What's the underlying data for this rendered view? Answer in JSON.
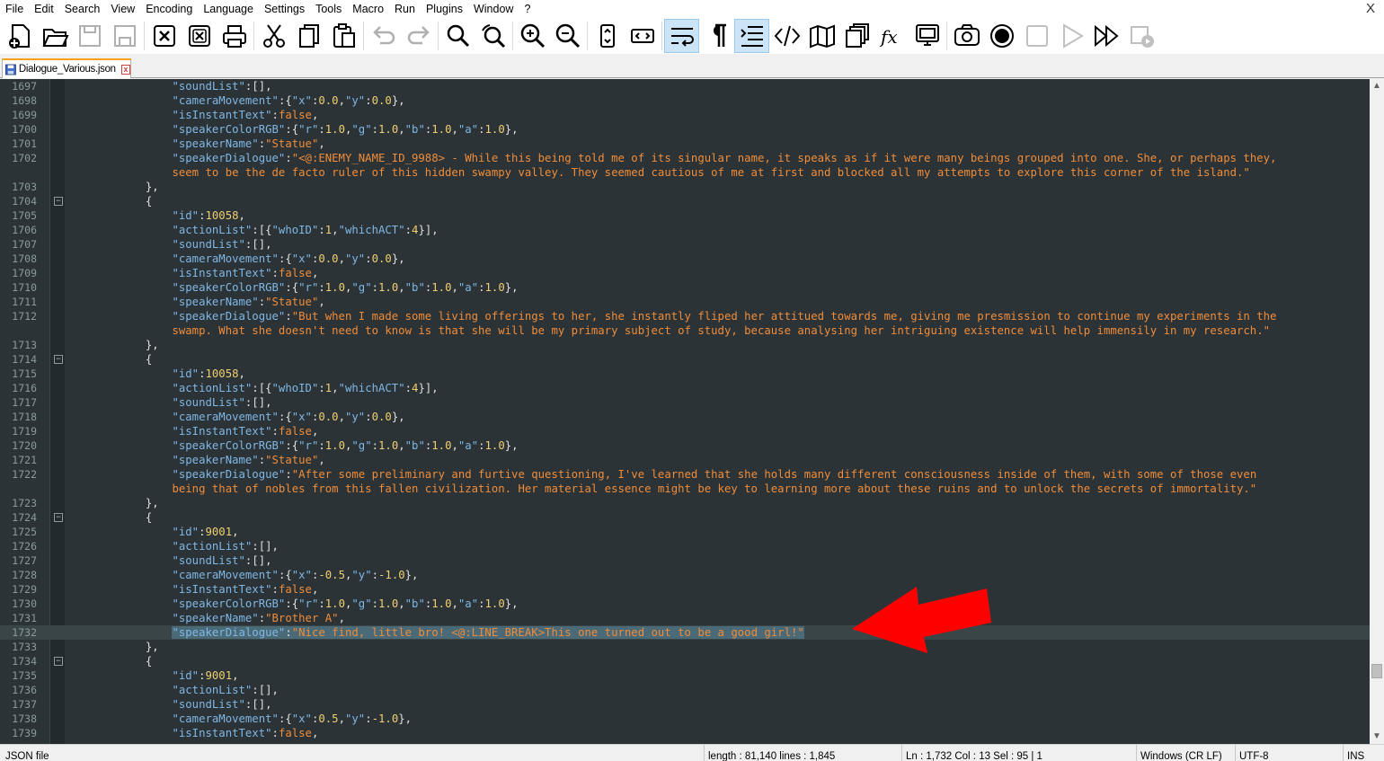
{
  "menu": {
    "items": [
      "File",
      "Edit",
      "Search",
      "View",
      "Encoding",
      "Language",
      "Settings",
      "Tools",
      "Macro",
      "Run",
      "Plugins",
      "Window",
      "?"
    ],
    "close_glyph": "X"
  },
  "toolbar": {
    "buttons": [
      "new-file",
      "open-file",
      "save",
      "save-all",
      "close",
      "close-all",
      "print",
      "cut",
      "copy",
      "paste",
      "undo",
      "redo",
      "find",
      "replace",
      "zoom-in",
      "zoom-out",
      "sync-vertical",
      "sync-horizontal",
      "word-wrap",
      "show-all-chars",
      "indent-guide",
      "udl",
      "document-map",
      "doc-list",
      "function-list",
      "folder-workspace",
      "monitoring",
      "record-macro",
      "stop-record",
      "playback",
      "run-multiple",
      "save-macro"
    ]
  },
  "tab": {
    "label": "Dialogue_Various.json",
    "close_glyph": "x"
  },
  "editor": {
    "accent_key": "#7fb7e6",
    "accent_string": "#f08c3a",
    "accent_number": "#f0d070",
    "lines": [
      {
        "n": "1697",
        "code": "                \"soundList\":[],"
      },
      {
        "n": "1698",
        "code": "                \"cameraMovement\":{\"x\":0.0,\"y\":0.0},"
      },
      {
        "n": "1699",
        "code": "                \"isInstantText\":false,"
      },
      {
        "n": "1700",
        "code": "                \"speakerColorRGB\":{\"r\":1.0,\"g\":1.0,\"b\":1.0,\"a\":1.0},"
      },
      {
        "n": "1701",
        "code": "                \"speakerName\":\"Statue\","
      },
      {
        "n": "1702",
        "code": "                \"speakerDialogue\":\"<@:ENEMY_NAME_ID_9988> - While this being told me of its singular name, it speaks as if it were many beings grouped into one. She, or perhaps they,"
      },
      {
        "n": "",
        "code": "                seem to be the de facto ruler of this hidden swampy valley. They seemed cautious of me at first and blocked all my attempts to explore this corner of the island.\""
      },
      {
        "n": "1703",
        "code": "            },"
      },
      {
        "n": "1704",
        "code": "            {",
        "fold": true
      },
      {
        "n": "1705",
        "code": "                \"id\":10058,"
      },
      {
        "n": "1706",
        "code": "                \"actionList\":[{\"whoID\":1,\"whichACT\":4}],"
      },
      {
        "n": "1707",
        "code": "                \"soundList\":[],"
      },
      {
        "n": "1708",
        "code": "                \"cameraMovement\":{\"x\":0.0,\"y\":0.0},"
      },
      {
        "n": "1709",
        "code": "                \"isInstantText\":false,"
      },
      {
        "n": "1710",
        "code": "                \"speakerColorRGB\":{\"r\":1.0,\"g\":1.0,\"b\":1.0,\"a\":1.0},"
      },
      {
        "n": "1711",
        "code": "                \"speakerName\":\"Statue\","
      },
      {
        "n": "1712",
        "code": "                \"speakerDialogue\":\"But when I made some living offerings to her, she instantly fliped her attitued towards me, giving me presmission to continue my experiments in the"
      },
      {
        "n": "",
        "code": "                swamp. What she doesn't need to know is that she will be my primary subject of study, because analysing her intriguing existence will help immensily in my research.\""
      },
      {
        "n": "1713",
        "code": "            },"
      },
      {
        "n": "1714",
        "code": "            {",
        "fold": true
      },
      {
        "n": "1715",
        "code": "                \"id\":10058,"
      },
      {
        "n": "1716",
        "code": "                \"actionList\":[{\"whoID\":1,\"whichACT\":4}],"
      },
      {
        "n": "1717",
        "code": "                \"soundList\":[],"
      },
      {
        "n": "1718",
        "code": "                \"cameraMovement\":{\"x\":0.0,\"y\":0.0},"
      },
      {
        "n": "1719",
        "code": "                \"isInstantText\":false,"
      },
      {
        "n": "1720",
        "code": "                \"speakerColorRGB\":{\"r\":1.0,\"g\":1.0,\"b\":1.0,\"a\":1.0},"
      },
      {
        "n": "1721",
        "code": "                \"speakerName\":\"Statue\","
      },
      {
        "n": "1722",
        "code": "                \"speakerDialogue\":\"After some preliminary and furtive questioning, I've learned that she holds many different consciousness inside of them, with some of those even"
      },
      {
        "n": "",
        "code": "                being that of nobles from this fallen civilization. Her material essence might be key to learning more about these ruins and to unlock the secrets of immortality.\""
      },
      {
        "n": "1723",
        "code": "            },"
      },
      {
        "n": "1724",
        "code": "            {",
        "fold": true
      },
      {
        "n": "1725",
        "code": "                \"id\":9001,"
      },
      {
        "n": "1726",
        "code": "                \"actionList\":[],"
      },
      {
        "n": "1727",
        "code": "                \"soundList\":[],"
      },
      {
        "n": "1728",
        "code": "                \"cameraMovement\":{\"x\":-0.5,\"y\":-1.0},"
      },
      {
        "n": "1729",
        "code": "                \"isInstantText\":false,"
      },
      {
        "n": "1730",
        "code": "                \"speakerColorRGB\":{\"r\":1.0,\"g\":1.0,\"b\":1.0,\"a\":1.0},"
      },
      {
        "n": "1731",
        "code": "                \"speakerName\":\"Brother A\","
      },
      {
        "n": "1732",
        "code": "                \"speakerDialogue\":\"Nice find, little bro! <@:LINE_BREAK>This one turned out to be a good girl!\"",
        "current": true
      },
      {
        "n": "1733",
        "code": "            },"
      },
      {
        "n": "1734",
        "code": "            {",
        "fold": true
      },
      {
        "n": "1735",
        "code": "                \"id\":9001,"
      },
      {
        "n": "1736",
        "code": "                \"actionList\":[],"
      },
      {
        "n": "1737",
        "code": "                \"soundList\":[],"
      },
      {
        "n": "1738",
        "code": "                \"cameraMovement\":{\"x\":0.5,\"y\":-1.0},"
      },
      {
        "n": "1739",
        "code": "                \"isInstantText\":false,"
      }
    ]
  },
  "scrollbar": {
    "up_glyph": "▲",
    "down_glyph": "▼"
  },
  "status": {
    "file_type": "JSON file",
    "length": "length : 81,140    lines : 1,845",
    "position": "Ln : 1,732    Col : 13    Sel : 95 | 1",
    "eol": "Windows (CR LF)",
    "encoding": "UTF-8",
    "mode": "INS"
  }
}
